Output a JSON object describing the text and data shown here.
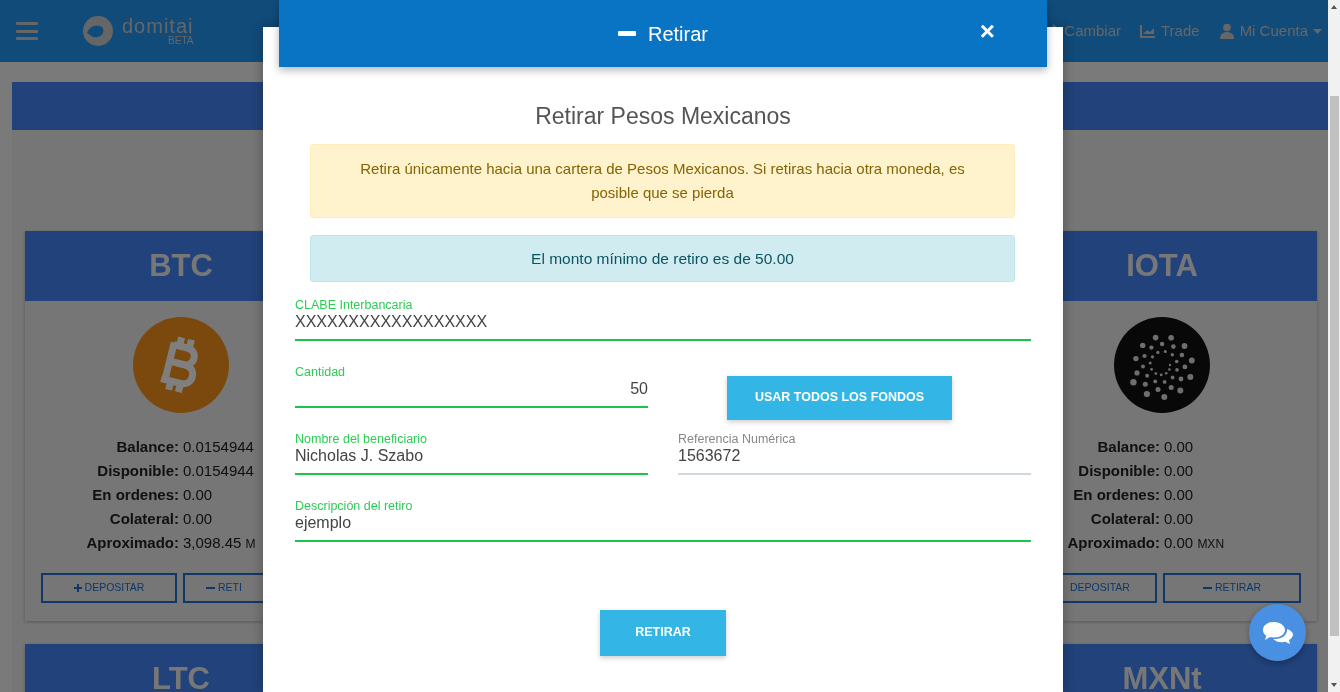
{
  "navbar": {
    "brand": "domitai",
    "brand_tag": "BETA",
    "links": [
      {
        "label": "Cambiar",
        "kind": "exchange",
        "dropdown": false
      },
      {
        "label": "Trade",
        "kind": "trade",
        "dropdown": false
      },
      {
        "label": "Mi Cuenta",
        "kind": "account",
        "dropdown": true
      }
    ]
  },
  "wallets": [
    {
      "ticker": "BTC",
      "kind": "bitcoin",
      "rows": [
        {
          "label": "Balance:",
          "value": "0.0154944"
        },
        {
          "label": "Disponible:",
          "value": "0.0154944"
        },
        {
          "label": "En ordenes:",
          "value": "0.00"
        },
        {
          "label": "Colateral:",
          "value": "0.00"
        },
        {
          "label": "Aproximado:",
          "value": "3,098.45",
          "unit": "M"
        }
      ],
      "buttons": [
        {
          "label": "DEPOSITAR",
          "kind": "deposit"
        },
        {
          "label": "RETI",
          "kind": "withdraw"
        }
      ]
    },
    {
      "ticker": "IOTA",
      "kind": "iota",
      "rows": [
        {
          "label": "Balance:",
          "value": "0.00"
        },
        {
          "label": "Disponible:",
          "value": "0.00"
        },
        {
          "label": "En ordenes:",
          "value": "0.00"
        },
        {
          "label": "Colateral:",
          "value": "0.00"
        },
        {
          "label": "Aproximado:",
          "value": "0.00",
          "unit": "MXN"
        }
      ],
      "buttons": [
        {
          "label": "DEPOSITAR",
          "kind": "deposit"
        },
        {
          "label": "RETIRAR",
          "kind": "withdraw"
        }
      ]
    },
    {
      "ticker": "LTC"
    },
    {
      "ticker": "MXNt"
    }
  ],
  "modal": {
    "title": "Retirar",
    "close": "×",
    "heading": "Retirar Pesos Mexicanos",
    "warning": "Retira únicamente hacia una cartera de Pesos Mexicanos. Si retiras hacia otra moneda, es posible que se pierda",
    "info": "El monto mínimo de retiro es de 50.00",
    "fields": [
      {
        "label": "CLABE Interbancaria",
        "value": "XXXXXXXXXXXXXXXXXX",
        "valid": true
      },
      {
        "label": "Cantidad",
        "value": "50",
        "valid": true
      },
      {
        "label": "Nombre del beneficiario",
        "value": "Nicholas J. Szabo",
        "valid": true
      },
      {
        "label": "Referencia Numérica",
        "value": "1563672",
        "valid": false
      },
      {
        "label": "Descripción del retiro",
        "value": "ejemplo",
        "valid": true
      }
    ],
    "fill_all_button": "USAR TODOS LOS FONDOS",
    "submit": "RETIRAR"
  }
}
